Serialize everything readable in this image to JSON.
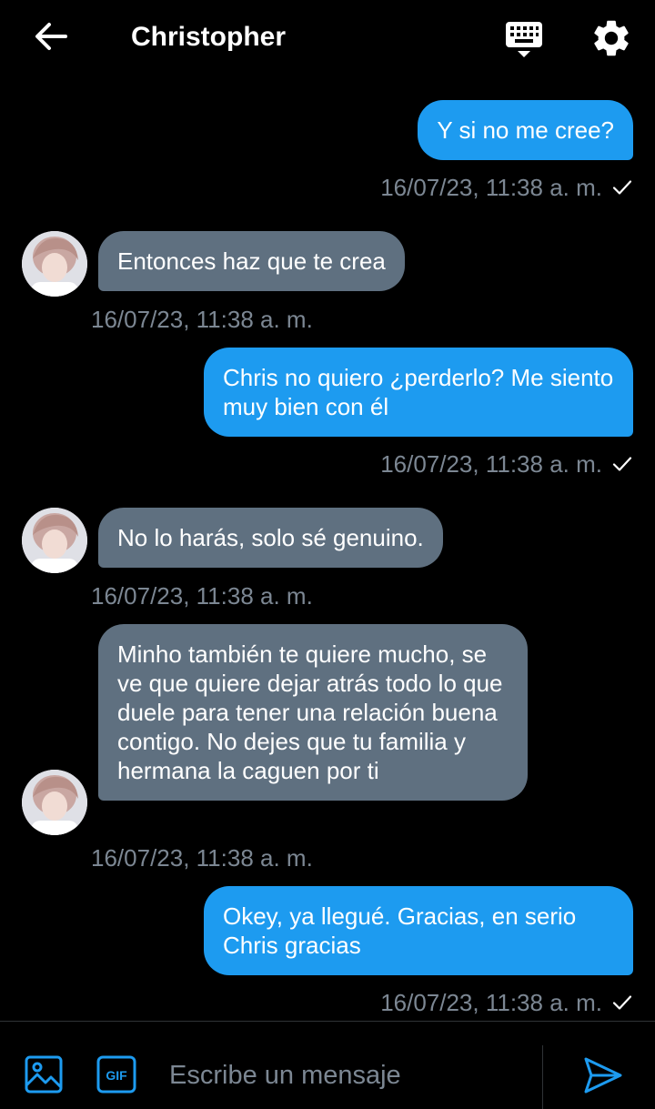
{
  "header": {
    "title": "Christopher",
    "icons": {
      "back": "arrow-left-icon",
      "keyboard": "keyboard-icon",
      "settings": "gear-icon"
    }
  },
  "colors": {
    "accent": "#1d9bf0",
    "incoming_bubble": "#5f7080",
    "meta_text": "#7c8793",
    "background": "#000000"
  },
  "messages": [
    {
      "direction": "out",
      "text": "Y si no me cree?",
      "timestamp": "16/07/23, 11:38 a. m.",
      "read": true
    },
    {
      "direction": "in",
      "text": "Entonces haz que te crea",
      "timestamp": "16/07/23, 11:38 a. m."
    },
    {
      "direction": "out",
      "text": "Chris no quiero ¿perderlo? Me siento muy bien con él",
      "timestamp": "16/07/23, 11:38 a. m.",
      "read": true
    },
    {
      "direction": "in",
      "text": "No lo harás, solo sé genuino.",
      "timestamp": "16/07/23, 11:38 a. m."
    },
    {
      "direction": "in",
      "text": "Minho también te quiere mucho, se ve que quiere dejar atrás todo lo que duele para tener una relación buena contigo. No dejes que tu familia y hermana la caguen por ti",
      "timestamp": "16/07/23, 11:38 a. m."
    },
    {
      "direction": "out",
      "text": "Okey, ya llegué. Gracias, en serio Chris gracias",
      "timestamp": "16/07/23, 11:38 a. m.",
      "read": true
    }
  ],
  "composer": {
    "placeholder": "Escribe un mensaje",
    "gif_label": "GIF",
    "icons": {
      "image": "image-icon",
      "gif": "gif-icon",
      "send": "send-icon"
    }
  }
}
